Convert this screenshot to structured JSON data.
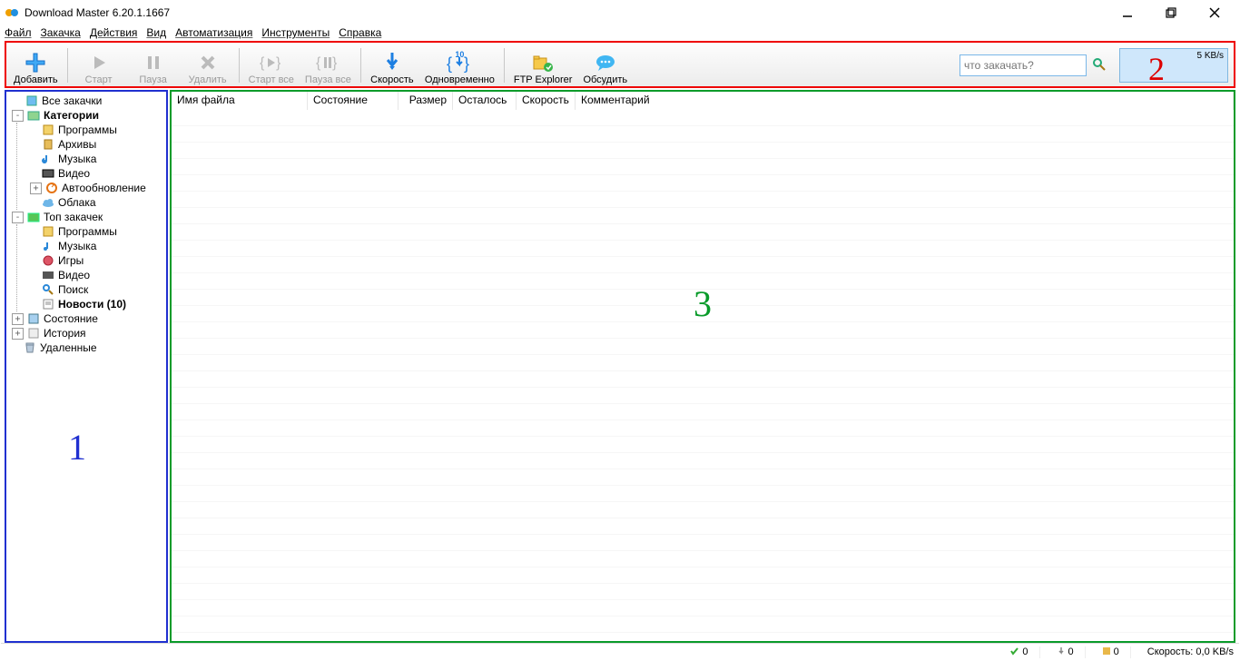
{
  "app_title": "Download Master 6.20.1.1667",
  "menubar": [
    "Файл",
    "Закачка",
    "Действия",
    "Вид",
    "Автоматизация",
    "Инструменты",
    "Справка"
  ],
  "toolbar": {
    "add": "Добавить",
    "start": "Старт",
    "pause": "Пауза",
    "delete": "Удалить",
    "start_all": "Старт все",
    "pause_all": "Пауза все",
    "speed": "Скорость",
    "concurrent": "Одновременно",
    "concurrent_count": "10",
    "ftp": "FTP Explorer",
    "discuss": "Обсудить",
    "search_placeholder": "что закачать?",
    "speed_box": "5 KB/s"
  },
  "overlay_labels": {
    "one": "1",
    "two": "2",
    "three": "3"
  },
  "tree": {
    "all": "Все закачки",
    "categories": "Категории",
    "cat_items": {
      "programs": "Программы",
      "archives": "Архивы",
      "music": "Музыка",
      "video": "Видео",
      "autoupdate": "Автообновление",
      "clouds": "Облака"
    },
    "top": "Топ закачек",
    "top_items": {
      "programs": "Программы",
      "music": "Музыка",
      "games": "Игры",
      "video": "Видео",
      "search": "Поиск",
      "news": "Новости (10)"
    },
    "status": "Состояние",
    "history": "История",
    "deleted": "Удаленные"
  },
  "columns": {
    "filename": "Имя файла",
    "state": "Состояние",
    "size": "Размер",
    "remaining": "Осталось",
    "speed": "Скорость",
    "comment": "Комментарий"
  },
  "statusbar": {
    "s1": "0",
    "s2": "0",
    "s3": "0",
    "speed": "Скорость: 0,0 KB/s"
  }
}
